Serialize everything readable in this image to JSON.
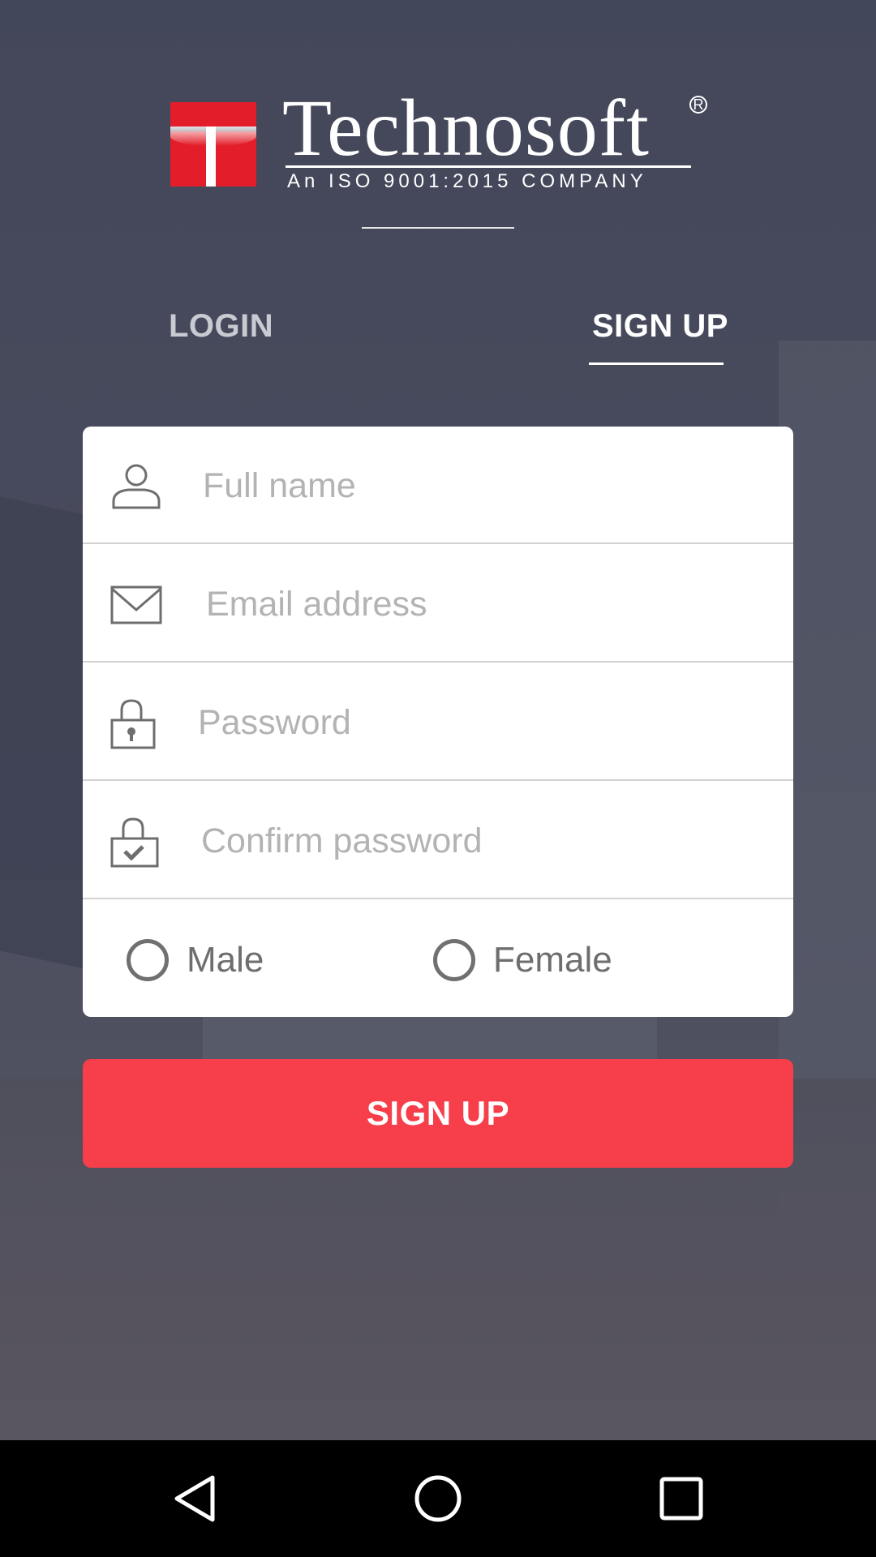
{
  "brand": {
    "name": "Technosoft",
    "registered": "R",
    "tagline": "An ISO 9001:2015 COMPANY",
    "colors": {
      "logo_red": "#e31e2a"
    }
  },
  "tabs": [
    {
      "label": "LOGIN",
      "active": false
    },
    {
      "label": "SIGN UP",
      "active": true
    }
  ],
  "form": {
    "fields": [
      {
        "name": "full-name",
        "icon": "user-icon",
        "placeholder": "Full name",
        "value": ""
      },
      {
        "name": "email",
        "icon": "envelope-icon",
        "placeholder": "Email address",
        "value": ""
      },
      {
        "name": "password",
        "icon": "lock-icon",
        "placeholder": "Password",
        "value": ""
      },
      {
        "name": "confirm-password",
        "icon": "lock-check-icon",
        "placeholder": "Confirm password",
        "value": ""
      }
    ],
    "gender": {
      "options": [
        {
          "label": "Male",
          "selected": false
        },
        {
          "label": "Female",
          "selected": false
        }
      ]
    },
    "submit_label": "SIGN UP"
  },
  "colors": {
    "accent": "#f73e4b",
    "card": "#ffffff",
    "placeholder": "#b3b3b3"
  },
  "navbar": {
    "icons": [
      "back-icon",
      "home-icon",
      "recents-icon"
    ]
  }
}
